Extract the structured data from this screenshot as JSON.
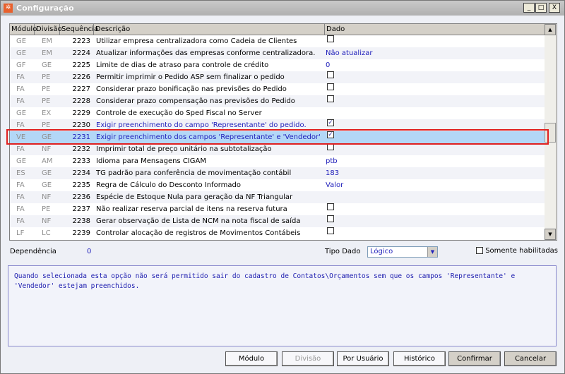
{
  "window": {
    "title": "Configuração",
    "minimize": "_",
    "maximize": "□",
    "close": "X"
  },
  "grid": {
    "columns": [
      "Módulo",
      "Divisão",
      "Sequência",
      "Descrição",
      "Dado"
    ],
    "rows": [
      {
        "modulo": "GE",
        "divisao": "EM",
        "seq": "2223",
        "desc": "Utilizar empresa centralizadora como Cadeia de Clientes",
        "dado": "",
        "checkbox": false,
        "blue": false
      },
      {
        "modulo": "GE",
        "divisao": "EM",
        "seq": "2224",
        "desc": "Atualizar informações das empresas conforme centralizadora.",
        "dado": "Não atualizar",
        "blue": false
      },
      {
        "modulo": "GF",
        "divisao": "GE",
        "seq": "2225",
        "desc": "Limite de dias de atraso para controle de crédito",
        "dado": "0",
        "blue": false
      },
      {
        "modulo": "FA",
        "divisao": "PE",
        "seq": "2226",
        "desc": "Permitir imprimir o Pedido ASP sem finalizar o pedido",
        "dado": "",
        "checkbox": false,
        "blue": false
      },
      {
        "modulo": "FA",
        "divisao": "PE",
        "seq": "2227",
        "desc": "Considerar prazo bonificação nas previsões do Pedido",
        "dado": "",
        "checkbox": false,
        "blue": false
      },
      {
        "modulo": "FA",
        "divisao": "PE",
        "seq": "2228",
        "desc": "Considerar prazo compensação nas previsões do Pedido",
        "dado": "",
        "checkbox": false,
        "blue": false
      },
      {
        "modulo": "GE",
        "divisao": "EX",
        "seq": "2229",
        "desc": "Controle de execução do Sped Fiscal no Server",
        "dado": "",
        "blue": false
      },
      {
        "modulo": "FA",
        "divisao": "PE",
        "seq": "2230",
        "desc": "Exigir preenchimento do campo 'Representante' do pedido.",
        "dado": "",
        "checkbox": true,
        "blue": true
      },
      {
        "modulo": "VE",
        "divisao": "GE",
        "seq": "2231",
        "desc": "Exigir preenchimento dos campos 'Representante' e 'Vendedor'",
        "dado": "",
        "checkbox": true,
        "blue": true,
        "selected": true
      },
      {
        "modulo": "FA",
        "divisao": "NF",
        "seq": "2232",
        "desc": "Imprimir total de preço unitário na subtotalização",
        "dado": "",
        "checkbox": false,
        "blue": false
      },
      {
        "modulo": "GE",
        "divisao": "AM",
        "seq": "2233",
        "desc": "Idioma para Mensagens CIGAM",
        "dado": "ptb",
        "blue": false
      },
      {
        "modulo": "ES",
        "divisao": "GE",
        "seq": "2234",
        "desc": "TG padrão para conferência de movimentação contábil",
        "dado": "183",
        "blue": false
      },
      {
        "modulo": "FA",
        "divisao": "GE",
        "seq": "2235",
        "desc": "Regra de Cálculo do Desconto Informado",
        "dado": "Valor",
        "blue": false
      },
      {
        "modulo": "FA",
        "divisao": "NF",
        "seq": "2236",
        "desc": "Espécie de Estoque Nula para geração da NF Triangular",
        "dado": "",
        "blue": false
      },
      {
        "modulo": "FA",
        "divisao": "PE",
        "seq": "2237",
        "desc": "Não realizar reserva parcial de itens na reserva futura",
        "dado": "",
        "checkbox": false,
        "blue": false
      },
      {
        "modulo": "FA",
        "divisao": "NF",
        "seq": "2238",
        "desc": "Gerar observação de Lista de NCM na nota fiscal de saída",
        "dado": "",
        "checkbox": false,
        "blue": false
      },
      {
        "modulo": "LF",
        "divisao": "LC",
        "seq": "2239",
        "desc": "Controlar alocação de registros de Movimentos Contábeis",
        "dado": "",
        "checkbox": false,
        "blue": false
      }
    ]
  },
  "footer": {
    "dependencia_label": "Dependência",
    "dependencia_value": "0",
    "tipo_dado_label": "Tipo Dado",
    "tipo_dado_value": "Lógico",
    "somente_label": "Somente habilitadas",
    "description": "Quando selecionada esta opção não será permitido sair do cadastro de Contatos\\Orçamentos sem que os campos 'Representante' e 'Vendedor' estejam preenchidos."
  },
  "buttons": {
    "modulo": "Módulo",
    "divisao": "Divisão",
    "por_usuario": "Por Usuário",
    "historico": "Histórico",
    "confirmar": "Confirmar",
    "cancelar": "Cancelar"
  },
  "colors": {
    "selection": "#b3d7f7",
    "highlight_border": "#e02020",
    "blue_text": "#2222bb"
  }
}
